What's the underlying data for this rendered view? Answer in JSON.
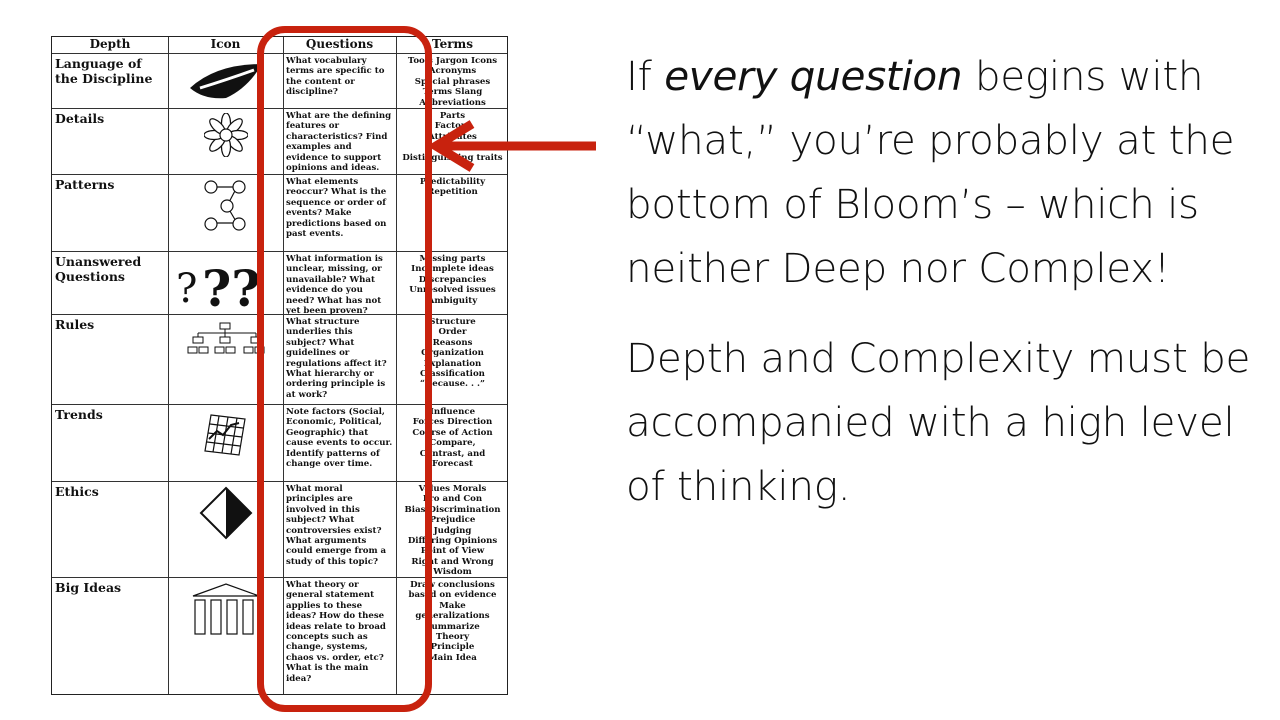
{
  "table": {
    "headers": [
      "Depth",
      "Icon",
      "Questions",
      "Terms"
    ],
    "rows": [
      {
        "depth": "Language of the Discipline",
        "icon": "lips-icon",
        "questions": "What vocabulary terms are specific to the content or discipline?",
        "terms": [
          "Tools Jargon Icons",
          "Acronyms",
          "Special phrases",
          "Terms Slang",
          "Abbreviations"
        ]
      },
      {
        "depth": "Details",
        "icon": "flower-icon",
        "questions": "What are the defining features or characteristics? Find examples and evidence to support opinions and ideas.",
        "terms": [
          "Parts",
          "Factors",
          "Attributes",
          "",
          "Distinguishing traits"
        ]
      },
      {
        "depth": "Patterns",
        "icon": "pattern-chain-icon",
        "questions": "What elements reoccur? What is the sequence or order of events? Make predictions based on past events.",
        "terms": [
          "Predictability",
          "Repetition"
        ]
      },
      {
        "depth": "Unanswered Questions",
        "icon": "question-marks-icon",
        "questions": "What information is unclear, missing, or unavailable? What evidence do you need? What has not yet been proven?",
        "terms": [
          "Missing parts",
          "Incomplete ideas",
          "Discrepancies",
          "Unresolved issues",
          "Ambiguity"
        ]
      },
      {
        "depth": "Rules",
        "icon": "hierarchy-icon",
        "questions": "What structure underlies this subject? What guidelines or regulations affect it? What hierarchy or ordering principle is at work?",
        "terms": [
          "Structure",
          "Order",
          "Reasons",
          "Organization",
          "Explanation",
          "Classification",
          "“Because. . .”"
        ]
      },
      {
        "depth": "Trends",
        "icon": "trend-chart-icon",
        "questions": "Note factors (Social, Economic, Political, Geographic) that cause events to occur. Identify patterns of change over time.",
        "terms": [
          "Influence",
          "Forces Direction",
          "Course of Action",
          "Compare,",
          "Contrast, and",
          "Forecast"
        ]
      },
      {
        "depth": "Ethics",
        "icon": "half-diamond-icon",
        "questions": "What moral principles are involved in this subject? What controversies exist? What arguments could emerge from a study of this topic?",
        "terms": [
          "Values Morals",
          "Pro and Con",
          "Bias Discrimination",
          "Prejudice",
          "Judging",
          "Differing Opinions",
          "Point of View",
          "Right and Wrong",
          "Wisdom"
        ]
      },
      {
        "depth": "Big Ideas",
        "icon": "temple-icon",
        "questions": "What theory or general statement applies to these ideas? How do these ideas relate to broad concepts such as change, systems, chaos vs. order, etc? What is the main idea?",
        "terms": [
          "Draw conclusions",
          "based on evidence",
          "Make",
          "generalizations",
          "Summarize",
          "Theory",
          "Principle",
          "Main Idea"
        ]
      }
    ]
  },
  "annotation": {
    "highlight_color": "#c8220e",
    "highlight_target": "Questions column",
    "arrow_icon": "arrow-left-icon"
  },
  "side_text": {
    "p1_prefix": "If ",
    "p1_emphasis": "every question",
    "p1_rest": " begins with “what,” you’re probably at the bottom of Bloom’s – which is neither Deep nor Complex!",
    "p2": "Depth and Complexity must be accompanied with a high level of thinking."
  }
}
